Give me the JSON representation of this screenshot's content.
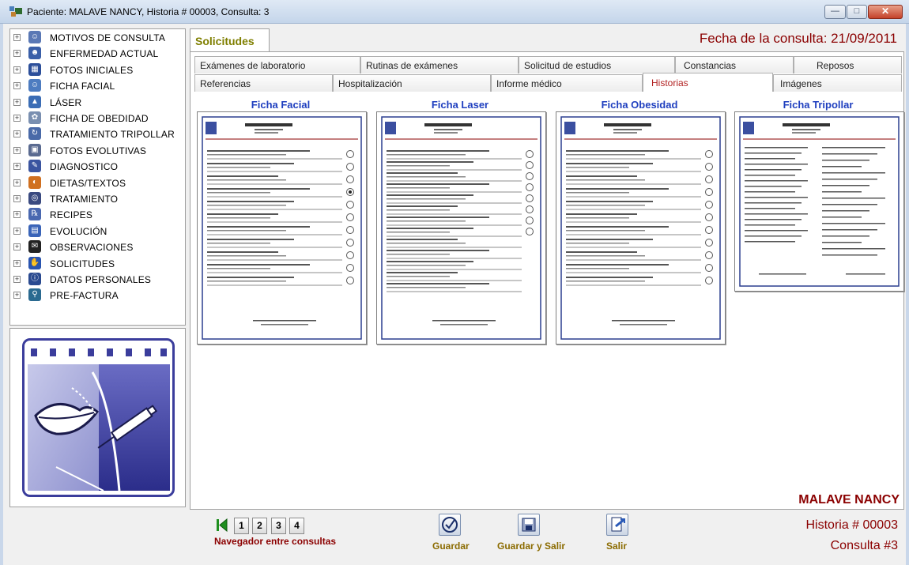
{
  "window": {
    "title": "Paciente: MALAVE  NANCY, Historia # 00003, Consulta: 3",
    "minimize_glyph": "—",
    "maximize_glyph": "□",
    "close_glyph": "✕"
  },
  "tree": {
    "expander_glyph": "+",
    "items": [
      {
        "label": "MOTIVOS DE CONSULTA",
        "icon": "person-outline-icon"
      },
      {
        "label": "ENFERMEDAD ACTUAL",
        "icon": "person-icon"
      },
      {
        "label": "FOTOS INICIALES",
        "icon": "photo-icon"
      },
      {
        "label": "FICHA FACIAL",
        "icon": "smiley-icon"
      },
      {
        "label": "LÁSER",
        "icon": "laser-icon"
      },
      {
        "label": "FICHA DE OBEDIDAD",
        "icon": "scale-icon"
      },
      {
        "label": "TRATAMIENTO TRIPOLLAR",
        "icon": "tripollar-icon"
      },
      {
        "label": "FOTOS EVOLUTIVAS",
        "icon": "photos-icon"
      },
      {
        "label": "DIAGNOSTICO",
        "icon": "pen-icon"
      },
      {
        "label": "DIETAS/TEXTOS",
        "icon": "apple-icon"
      },
      {
        "label": "TRATAMIENTO",
        "icon": "stethoscope-icon"
      },
      {
        "label": "RECIPES",
        "icon": "recipe-icon"
      },
      {
        "label": "EVOLUCIÓN",
        "icon": "chart-icon"
      },
      {
        "label": "OBSERVACIONES",
        "icon": "notes-icon"
      },
      {
        "label": "SOLICITUDES",
        "icon": "hand-icon"
      },
      {
        "label": "DATOS PERSONALES",
        "icon": "info-icon"
      },
      {
        "label": "PRE-FACTURA",
        "icon": "magnifier-icon"
      }
    ]
  },
  "main": {
    "section_tab": "Solicitudes",
    "fecha": "Fecha de la consulta:  21/09/2011",
    "tabs_row1": [
      "Exámenes de laboratorio",
      "Rutinas de exámenes",
      "Solicitud de estudios",
      "Constancias",
      "Reposos"
    ],
    "tabs_row2": [
      "Referencias",
      "Hospitalización",
      "Informe médico",
      "Historias",
      "Imágenes"
    ],
    "active_tab": "Historias",
    "cards": [
      {
        "title": "Ficha Facial"
      },
      {
        "title": "Ficha Laser"
      },
      {
        "title": "Ficha Obesidad"
      },
      {
        "title": "Ficha Tripollar"
      }
    ]
  },
  "patient": {
    "name": "MALAVE  NANCY",
    "historia": "Historia # 00003",
    "consulta": "Consulta #3"
  },
  "navigator": {
    "buttons": [
      "1",
      "2",
      "3",
      "4"
    ],
    "label": "Navegador entre consultas"
  },
  "actions": {
    "guardar": "Guardar",
    "guardar_salir": "Guardar y Salir",
    "salir": "Salir"
  },
  "colors": {
    "accent_red": "#8b0000",
    "title_blue": "#1f3fbf",
    "section_olive": "#7f7f00",
    "logo_purple": "#3b3d9c"
  }
}
